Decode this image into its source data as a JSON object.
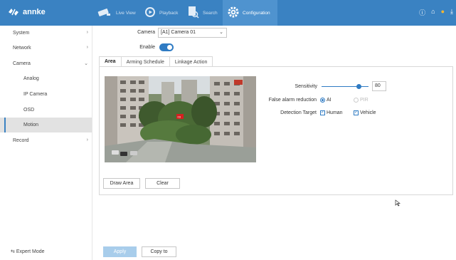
{
  "app": {
    "logo_text": "annke"
  },
  "topnav": {
    "items": [
      {
        "label": "Live View",
        "icon": "camera-icon"
      },
      {
        "label": "Playback",
        "icon": "playback-icon"
      },
      {
        "label": "Search",
        "icon": "search-icon"
      },
      {
        "label": "Configuration",
        "icon": "gear-icon"
      }
    ],
    "active": "Configuration",
    "right_icons": [
      "info-icon",
      "home-icon",
      "notification-icon",
      "download-icon"
    ]
  },
  "sidebar": {
    "items": [
      {
        "label": "System",
        "expandable": true
      },
      {
        "label": "Network",
        "expandable": true
      },
      {
        "label": "Camera",
        "expandable": true,
        "expanded": true
      },
      {
        "label": "Analog"
      },
      {
        "label": "IP Camera"
      },
      {
        "label": "OSD"
      },
      {
        "label": "Motion",
        "selected": true
      },
      {
        "label": "Record",
        "expandable": true
      }
    ],
    "expert_mode": "Expert Mode"
  },
  "form": {
    "camera_label": "Camera",
    "camera_value": "[A1] Camera 01",
    "enable_label": "Enable",
    "enable_on": true
  },
  "tabs": [
    {
      "label": "Area",
      "active": true
    },
    {
      "label": "Arming Schedule"
    },
    {
      "label": "Linkage Action"
    }
  ],
  "settings": {
    "sensitivity_label": "Sensitivity",
    "sensitivity_value": "80",
    "false_alarm_label": "False alarm reduction",
    "false_alarm_ai": "AI",
    "false_alarm_pir": "PIR",
    "detection_target_label": "Detection Target",
    "target_human": "Human",
    "target_vehicle": "Vehicle"
  },
  "area_buttons": {
    "draw": "Draw Area",
    "clear": "Clear"
  },
  "footer": {
    "apply": "Apply",
    "copy_to": "Copy to"
  },
  "colors": {
    "accent": "#3a82c2",
    "topbar": "#3a82c2",
    "selected_bg": "#e2e2e2"
  }
}
